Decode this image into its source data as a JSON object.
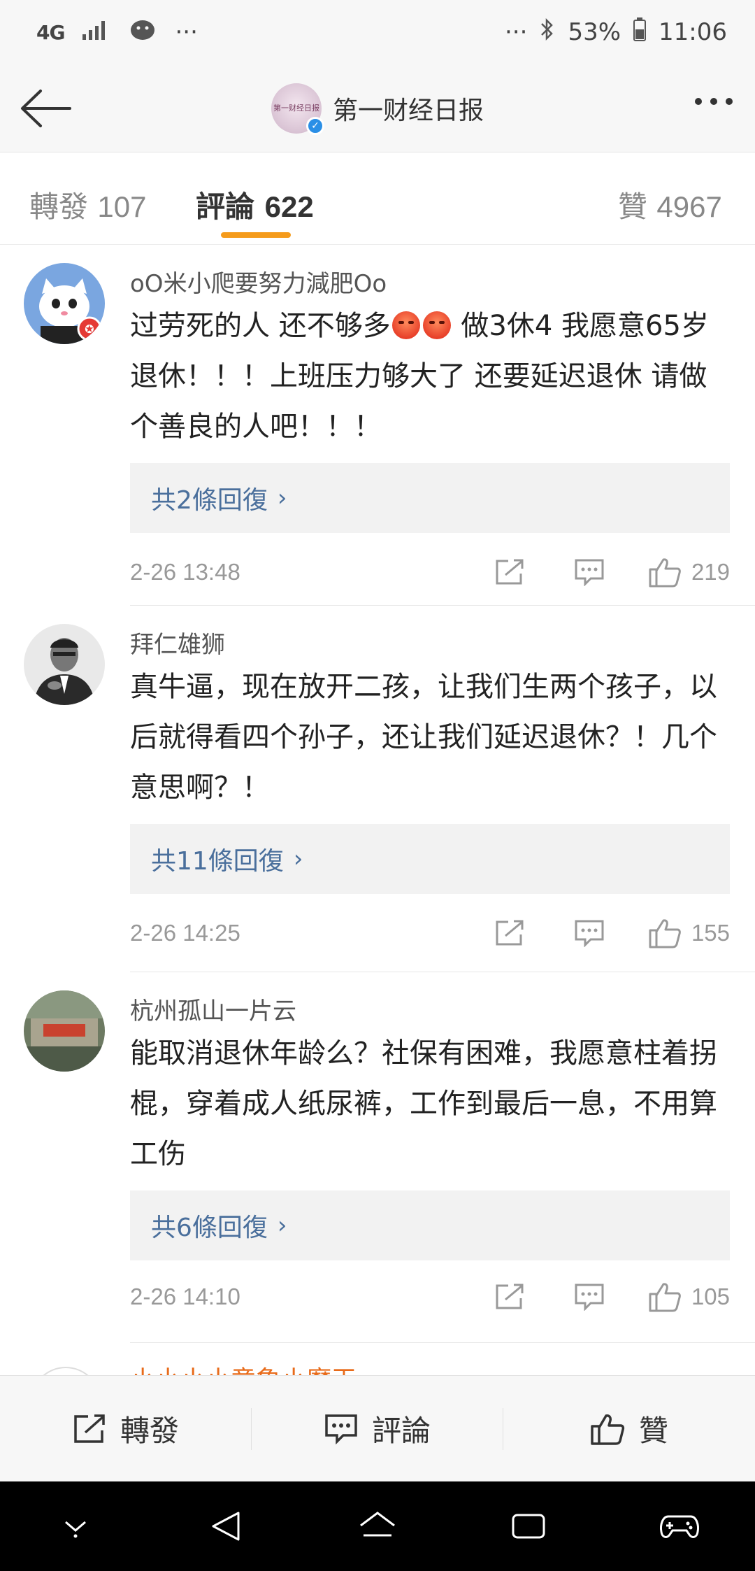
{
  "status_bar": {
    "network": "4G",
    "extra": "···",
    "right_dots": "···",
    "battery": "53%",
    "time": "11:06"
  },
  "header": {
    "title": "第一财经日报",
    "avatar_text": "第一财经日报"
  },
  "tabs": [
    {
      "label": "轉發",
      "count": "107"
    },
    {
      "label": "評論",
      "count": "622"
    },
    {
      "label": "贊",
      "count": "4967"
    }
  ],
  "comments": [
    {
      "user": "oO米小爬要努力減肥Oo",
      "text_before": "过劳死的人 还不够多",
      "text_after": " 做3休4 我愿意65岁退休！！！上班压力够大了 还要延迟退休 请做个善良的人吧！！！",
      "replies": "共2條回復",
      "time": "2-26 13:48",
      "likes": "219"
    },
    {
      "user": "拜仁雄狮",
      "text_before": "真牛逼，现在放开二孩，让我们生两个孩子，以后就得看四个孙子，还让我们延迟退休？！几个意思啊？！",
      "replies": "共11條回復",
      "time": "2-26 14:25",
      "likes": "155"
    },
    {
      "user": "杭州孤山一片云",
      "text_before": "能取消退休年龄么？社保有困难，我愿意柱着拐棍，穿着成人纸尿裤，工作到最后一息，不用算工伤",
      "replies": "共6條回復",
      "time": "2-26 14:10",
      "likes": "105"
    }
  ],
  "peek": {
    "user": "小小小小意象小魔王"
  },
  "toolbar": {
    "repost": "轉發",
    "comment": "評論",
    "like": "贊"
  },
  "colors": {
    "accent": "#f59b1b",
    "link": "#4a6f9c",
    "verified": "#2b8fe6"
  }
}
